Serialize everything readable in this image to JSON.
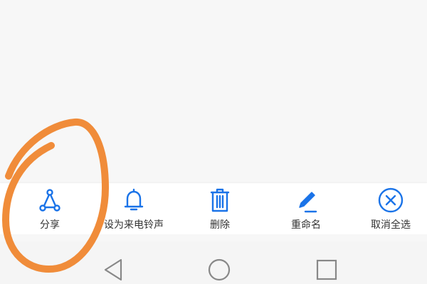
{
  "theme": {
    "accent": "#1a73e8",
    "label_color": "#333333",
    "annotation_color": "#f08c3a",
    "nav_icon_color": "#888888"
  },
  "actions": [
    {
      "label": "分享",
      "icon": "share-icon"
    },
    {
      "label": "设为来电铃声",
      "icon": "bell-icon"
    },
    {
      "label": "删除",
      "icon": "trash-icon"
    },
    {
      "label": "重命名",
      "icon": "pencil-icon"
    },
    {
      "label": "取消全选",
      "icon": "cancel-circle-icon"
    }
  ],
  "nav": [
    {
      "icon": "back-triangle-icon"
    },
    {
      "icon": "home-circle-icon"
    },
    {
      "icon": "recents-square-icon"
    }
  ]
}
